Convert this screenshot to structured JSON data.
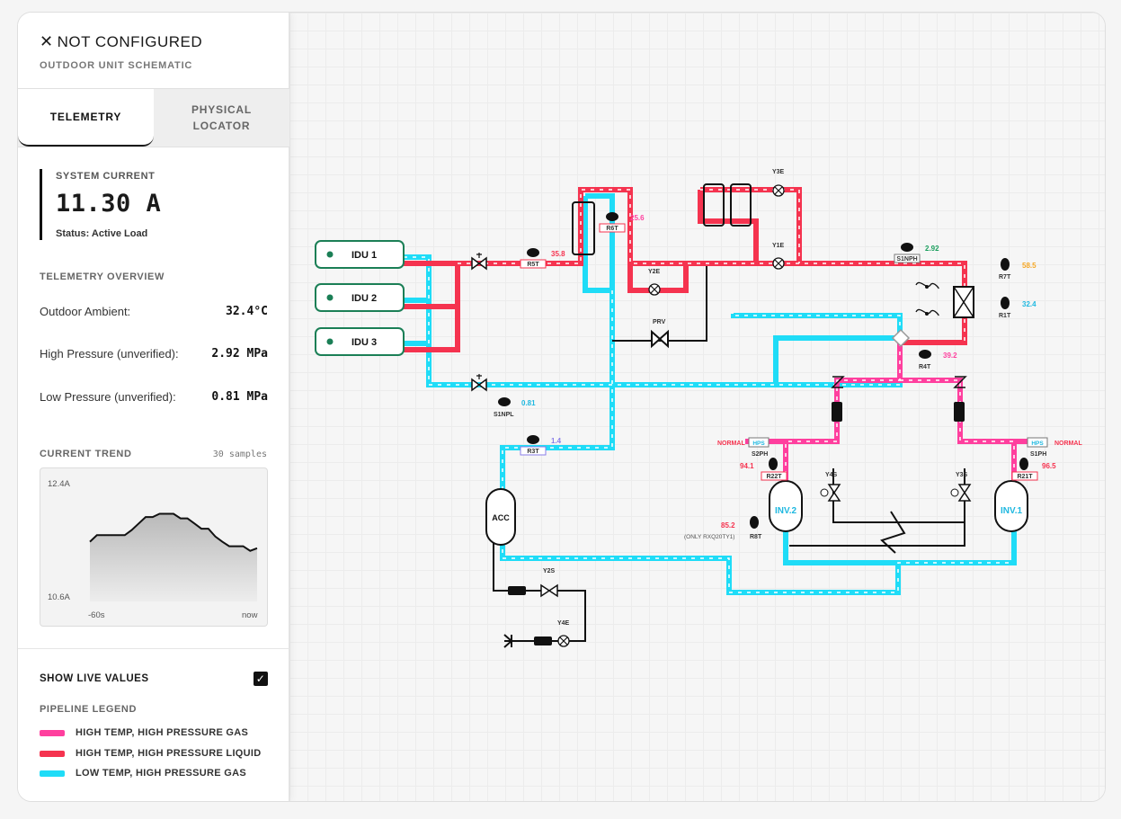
{
  "header": {
    "title": "NOT CONFIGURED",
    "subtitle": "OUTDOOR UNIT SCHEMATIC"
  },
  "tabs": [
    {
      "label": "TELEMETRY",
      "active": true
    },
    {
      "label": "PHYSICAL LOCATOR",
      "active": false
    }
  ],
  "system": {
    "label": "SYSTEM CURRENT",
    "value": "11.30 A",
    "status": "Status: Active Load"
  },
  "overview": {
    "label": "TELEMETRY OVERVIEW",
    "rows": [
      {
        "label": "Outdoor Ambient:",
        "value": "32.4°C"
      },
      {
        "label": "High Pressure (unverified):",
        "value": "2.92 MPa"
      },
      {
        "label": "Low Pressure (unverified):",
        "value": "0.81 MPa"
      }
    ]
  },
  "trend": {
    "label": "CURRENT TREND",
    "samples": "30 samples",
    "y_max": "12.4A",
    "y_min": "10.6A",
    "x_start": "-60s",
    "x_end": "now",
    "chart_data": {
      "type": "area",
      "ylim": [
        10.6,
        12.4
      ],
      "values": [
        11.52,
        11.62,
        11.62,
        11.62,
        11.62,
        11.62,
        11.7,
        11.8,
        11.9,
        11.9,
        11.95,
        11.95,
        11.95,
        11.88,
        11.88,
        11.8,
        11.72,
        11.72,
        11.6,
        11.52,
        11.45,
        11.45,
        11.45,
        11.38,
        11.42
      ]
    }
  },
  "live": {
    "label": "SHOW LIVE VALUES",
    "checked": true
  },
  "legend": {
    "label": "PIPELINE LEGEND",
    "items": [
      {
        "label": "HIGH TEMP, HIGH PRESSURE GAS",
        "color": "#ff3f9e"
      },
      {
        "label": "HIGH TEMP, HIGH PRESSURE LIQUID",
        "color": "#f5334f"
      },
      {
        "label": "LOW TEMP, HIGH PRESSURE GAS",
        "color": "#1fdcf7"
      }
    ]
  },
  "schematic": {
    "idus": [
      "IDU 1",
      "IDU 2",
      "IDU 3"
    ],
    "accumulator": "ACC",
    "inverters": [
      "INV.2",
      "INV.1"
    ],
    "prv": "PRV",
    "valves": [
      "Y3E",
      "Y1E",
      "Y2E",
      "Y4S",
      "Y3S",
      "Y2S",
      "Y4E"
    ],
    "hps": [
      "HPS",
      "HPS"
    ],
    "sensors": {
      "r5t": {
        "tag": "R5T",
        "value": "35.8"
      },
      "r6t": {
        "tag": "R6T",
        "value": "25.6"
      },
      "s1nph": {
        "tag": "S1NPH",
        "value": "2.92"
      },
      "r7t": {
        "tag": "R7T",
        "value": "58.5"
      },
      "r1t": {
        "tag": "R1T",
        "value": "32.4"
      },
      "r4t": {
        "tag": "R4T",
        "value": "39.2"
      },
      "s1npl": {
        "tag": "S1NPL",
        "value": "0.81"
      },
      "r3t": {
        "tag": "R3T",
        "value": "1.4"
      },
      "r22t": {
        "tag": "R22T",
        "value": "94.1"
      },
      "r21t": {
        "tag": "R21T",
        "value": "96.5"
      },
      "r8t": {
        "tag": "R8T",
        "value": "85.2",
        "note": "(ONLY RXQ20TY1)"
      },
      "s2ph": {
        "tag": "S2PH",
        "state": "NORMAL"
      },
      "s1ph": {
        "tag": "S1PH",
        "state": "NORMAL"
      }
    },
    "colors": {
      "hot_gas": "#ff3f9e",
      "hot_liquid": "#f5334f",
      "cold_gas": "#1fdcf7",
      "idu_border": "#1b7f56"
    }
  }
}
